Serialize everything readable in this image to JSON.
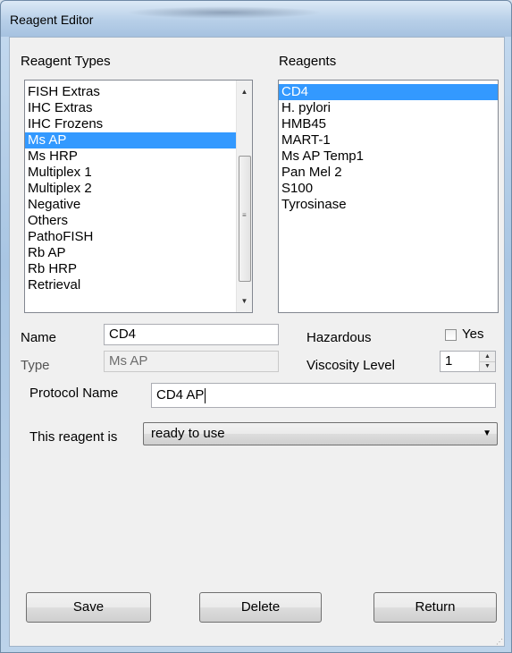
{
  "window": {
    "title": "Reagent Editor"
  },
  "reagent_types": {
    "label": "Reagent Types",
    "items": [
      "FISH Extras",
      "IHC Extras",
      "IHC Frozens",
      "Ms AP",
      "Ms HRP",
      "Multiplex 1",
      "Multiplex 2",
      "Negative",
      "Others",
      "PathoFISH",
      "Rb AP",
      "Rb HRP",
      "Retrieval"
    ],
    "selected": "Ms AP"
  },
  "reagents": {
    "label": "Reagents",
    "items": [
      "CD4",
      "H. pylori",
      "HMB45",
      "MART-1",
      "Ms AP Temp1",
      "Pan Mel 2",
      "S100",
      "Tyrosinase"
    ],
    "selected": "CD4"
  },
  "form": {
    "name_label": "Name",
    "name_value": "CD4",
    "type_label": "Type",
    "type_value": "Ms AP",
    "hazardous_label": "Hazardous",
    "hazardous_option": "Yes",
    "viscosity_label": "Viscosity Level",
    "viscosity_value": "1",
    "protocol_label": "Protocol Name",
    "protocol_value": "CD4 AP",
    "reagent_is_label": "This reagent is",
    "reagent_is_value": "ready to use"
  },
  "buttons": {
    "save": "Save",
    "delete": "Delete",
    "return": "Return"
  },
  "icons": {
    "scroll_up": "▲",
    "scroll_down": "▼",
    "combo_arrow": "▼"
  }
}
